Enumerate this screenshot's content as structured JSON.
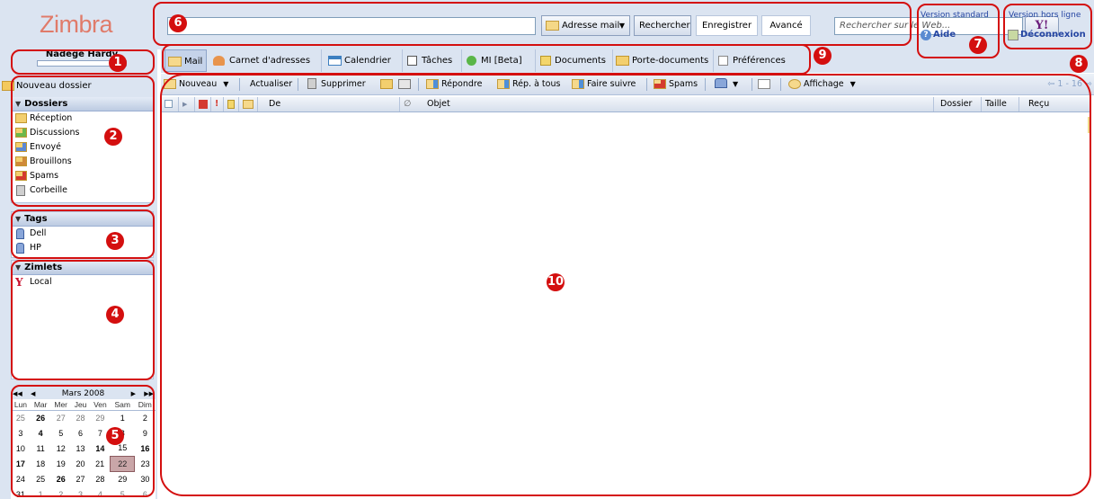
{
  "header": {
    "logo_text": "Zimbra",
    "search": {
      "value": "",
      "scope_button_label": "Adresse mail",
      "search_button_label": "Rechercher",
      "save_button_label": "Enregistrer",
      "advanced_button_label": "Avancé",
      "web_search_placeholder": "Rechercher sur le Web..."
    },
    "version_standard_label": "Version standard",
    "help_label": "Aide",
    "offline_version_label": "Version hors ligne",
    "logout_label": "Déconnexion"
  },
  "sidebar": {
    "user_name": "Nadège Hardy",
    "new_folder_label": "Nouveau dossier",
    "folders": {
      "header": "Dossiers",
      "items": [
        {
          "label": "Réception",
          "icon": "inbox-folder-icon"
        },
        {
          "label": "Discussions",
          "icon": "chats-folder-icon"
        },
        {
          "label": "Envoyé",
          "icon": "sent-folder-icon"
        },
        {
          "label": "Brouillons",
          "icon": "drafts-folder-icon"
        },
        {
          "label": "Spams",
          "icon": "spam-folder-icon"
        },
        {
          "label": "Corbeille",
          "icon": "trash-icon"
        }
      ]
    },
    "tags": {
      "header": "Tags",
      "items": [
        {
          "label": "Dell",
          "icon": "tag-icon"
        },
        {
          "label": "HP",
          "icon": "tag-icon"
        }
      ]
    },
    "zimlets": {
      "header": "Zimlets",
      "items": [
        {
          "label": "Local",
          "icon": "yahoo-icon"
        }
      ]
    }
  },
  "calendar": {
    "month_label": "Mars 2008",
    "weekdays": [
      "Lun",
      "Mar",
      "Mer",
      "Jeu",
      "Ven",
      "Sam",
      "Dim"
    ],
    "weeks": [
      [
        {
          "d": "25",
          "out": true
        },
        {
          "d": "26",
          "bold": true
        },
        {
          "d": "27",
          "out": true
        },
        {
          "d": "28",
          "out": true
        },
        {
          "d": "29",
          "out": true
        },
        {
          "d": "1"
        },
        {
          "d": "2"
        }
      ],
      [
        {
          "d": "3"
        },
        {
          "d": "4",
          "bold": true
        },
        {
          "d": "5"
        },
        {
          "d": "6"
        },
        {
          "d": "7"
        },
        {
          "d": "8"
        },
        {
          "d": "9"
        }
      ],
      [
        {
          "d": "10"
        },
        {
          "d": "11"
        },
        {
          "d": "12"
        },
        {
          "d": "13"
        },
        {
          "d": "14",
          "bold": true
        },
        {
          "d": "15"
        },
        {
          "d": "16",
          "bold": true
        }
      ],
      [
        {
          "d": "17",
          "bold": true
        },
        {
          "d": "18"
        },
        {
          "d": "19"
        },
        {
          "d": "20"
        },
        {
          "d": "21"
        },
        {
          "d": "22",
          "today": true
        },
        {
          "d": "23"
        }
      ],
      [
        {
          "d": "24"
        },
        {
          "d": "25"
        },
        {
          "d": "26",
          "bold": true
        },
        {
          "d": "27"
        },
        {
          "d": "28"
        },
        {
          "d": "29"
        },
        {
          "d": "30"
        }
      ],
      [
        {
          "d": "31"
        },
        {
          "d": "1",
          "out": true
        },
        {
          "d": "2",
          "out": true
        },
        {
          "d": "3",
          "out": true
        },
        {
          "d": "4",
          "out": true
        },
        {
          "d": "5",
          "out": true
        },
        {
          "d": "6",
          "out": true
        }
      ]
    ]
  },
  "tabs": [
    {
      "label": "Mail",
      "icon": "envelope-icon",
      "active": true
    },
    {
      "label": "Carnet d'adresses",
      "icon": "contacts-icon"
    },
    {
      "label": "Calendrier",
      "icon": "calendar-icon"
    },
    {
      "label": "Tâches",
      "icon": "tasks-icon"
    },
    {
      "label": "MI [Beta]",
      "icon": "chat-bubble-icon"
    },
    {
      "label": "Documents",
      "icon": "documents-icon"
    },
    {
      "label": "Porte-documents",
      "icon": "briefcase-icon"
    },
    {
      "label": "Préférences",
      "icon": "preferences-icon"
    }
  ],
  "toolbar": {
    "new_label": "Nouveau",
    "refresh_label": "Actualiser",
    "delete_label": "Supprimer",
    "reply_label": "Répondre",
    "reply_all_label": "Rép. à tous",
    "forward_label": "Faire suivre",
    "spam_label": "Spams",
    "view_label": "Affichage",
    "pager_label": "1 - 16"
  },
  "list_columns": {
    "from": "De",
    "subject": "Objet",
    "folder": "Dossier",
    "size": "Taille",
    "received": "Reçu"
  },
  "callouts": [
    "1",
    "2",
    "3",
    "4",
    "5",
    "6",
    "7",
    "8",
    "9",
    "10"
  ],
  "colors": {
    "callout_red": "#d40f0f",
    "chrome_blue": "#dbe4f1",
    "logo_salmon": "#e07b6a",
    "today_highlight": "#c9a6a8"
  }
}
